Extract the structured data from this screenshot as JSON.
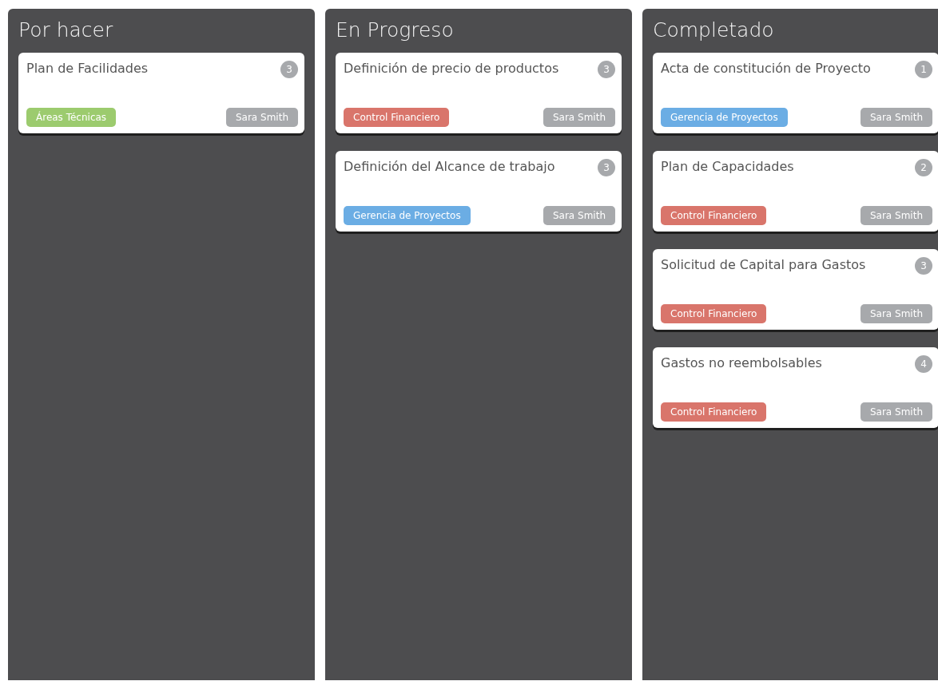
{
  "columns": [
    {
      "title": "Por hacer",
      "cards": [
        {
          "title": "Plan de Facilidades",
          "count": "3",
          "tag": {
            "label": "Áreas Técnicas",
            "color": "#9ccb6e"
          },
          "assignee": "Sara Smith"
        }
      ]
    },
    {
      "title": "En Progreso",
      "cards": [
        {
          "title": "Definición de precio de productos",
          "count": "3",
          "tag": {
            "label": "Control Financiero",
            "color": "#d9756b"
          },
          "assignee": "Sara Smith"
        },
        {
          "title": "Definición del Alcance de trabajo",
          "count": "3",
          "tag": {
            "label": "Gerencia de Proyectos",
            "color": "#6badE4"
          },
          "assignee": "Sara Smith"
        }
      ]
    },
    {
      "title": "Completado",
      "cards": [
        {
          "title": "Acta de constitución de Proyecto",
          "count": "1",
          "tag": {
            "label": "Gerencia de Proyectos",
            "color": "#6bade4"
          },
          "assignee": "Sara Smith"
        },
        {
          "title": "Plan de Capacidades",
          "count": "2",
          "tag": {
            "label": "Control Financiero",
            "color": "#d9756b"
          },
          "assignee": "Sara Smith"
        },
        {
          "title": "Solicitud de Capital para Gastos",
          "count": "3",
          "tag": {
            "label": "Control Financiero",
            "color": "#d9756b"
          },
          "assignee": "Sara Smith"
        },
        {
          "title": "Gastos no reembolsables",
          "count": "4",
          "tag": {
            "label": "Control Financiero",
            "color": "#d9756b"
          },
          "assignee": "Sara Smith"
        }
      ]
    }
  ]
}
